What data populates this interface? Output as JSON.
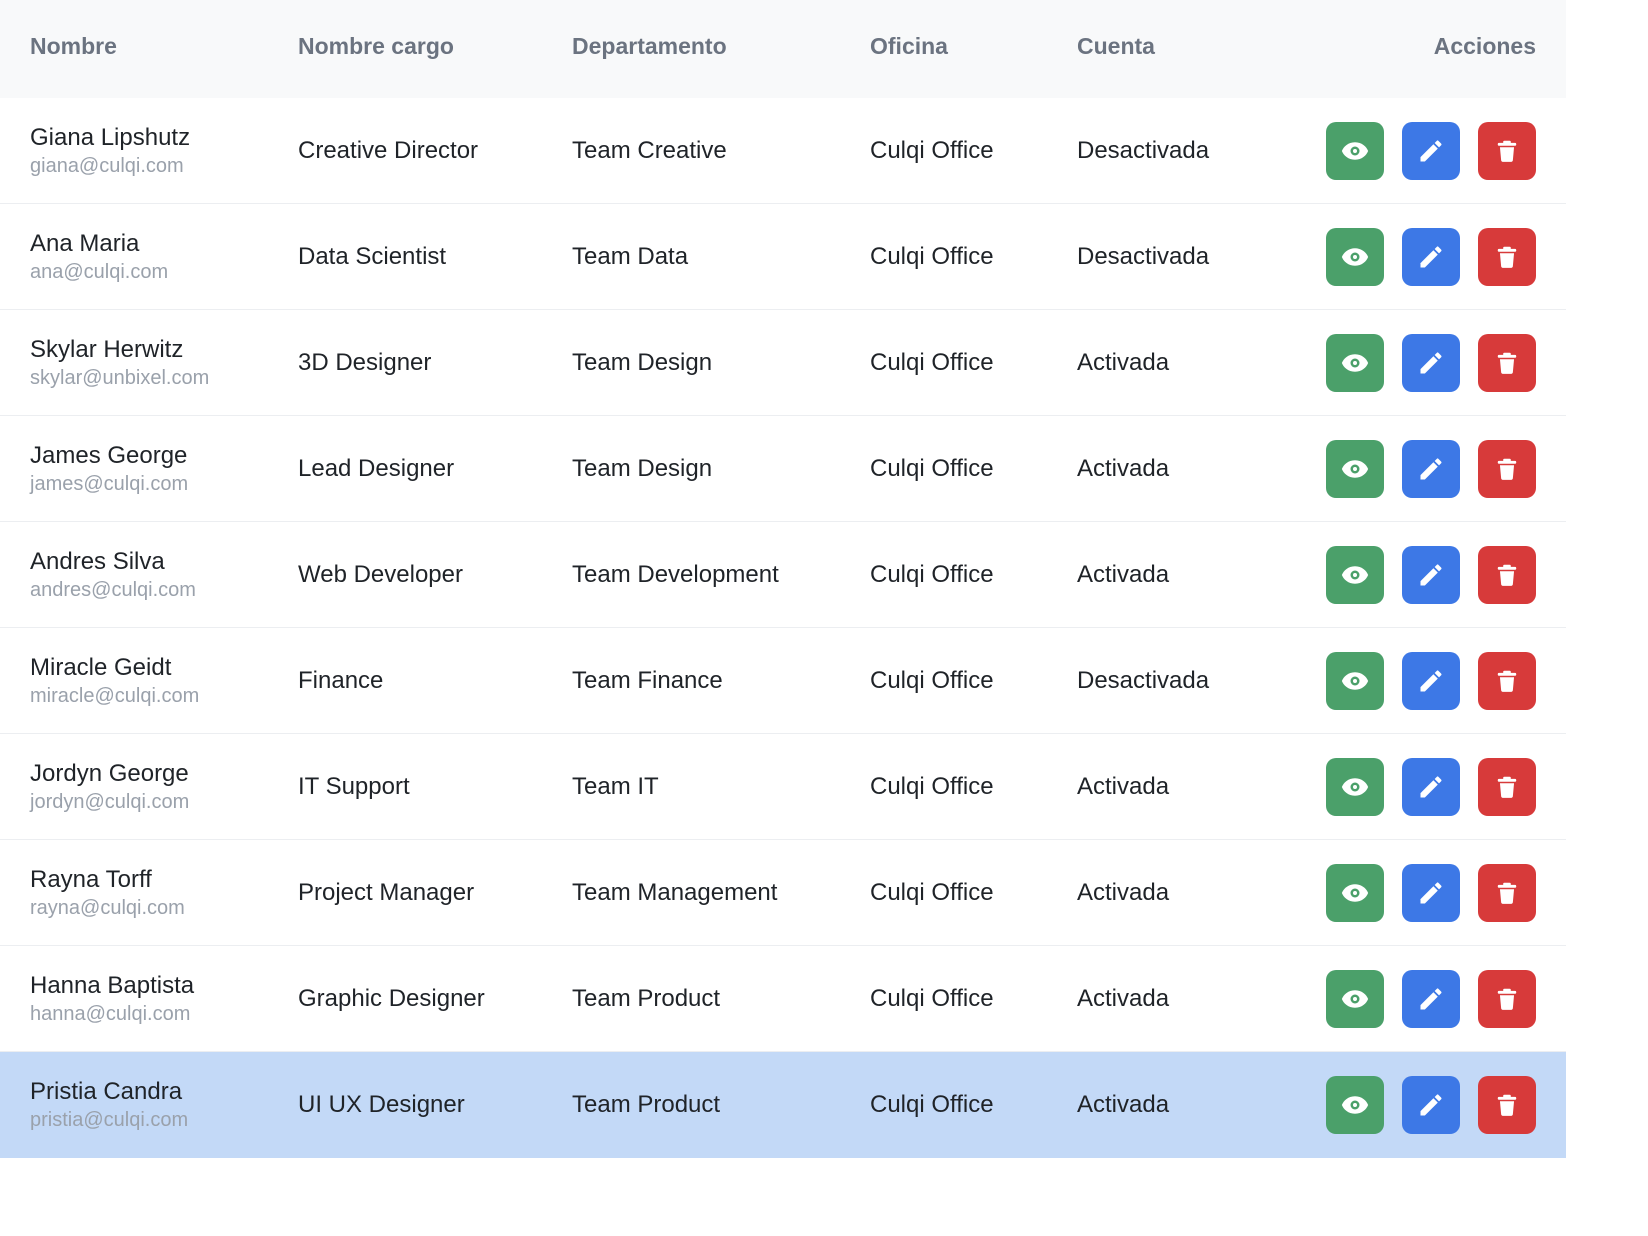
{
  "colors": {
    "view_button": "#4ba06a",
    "edit_button": "#3d78e6",
    "delete_button": "#d73a3a",
    "header_bg": "#f8f9fa",
    "selected_row_bg": "#c3d9f7"
  },
  "table": {
    "headers": {
      "name": "Nombre",
      "position": "Nombre cargo",
      "department": "Departamento",
      "office": "Oficina",
      "account": "Cuenta",
      "actions": "Acciones"
    },
    "rows": [
      {
        "name": "Giana Lipshutz",
        "email": "giana@culqi.com",
        "position": "Creative Director",
        "department": "Team Creative",
        "office": "Culqi Office",
        "account": "Desactivada"
      },
      {
        "name": "Ana Maria",
        "email": "ana@culqi.com",
        "position": "Data Scientist",
        "department": "Team Data",
        "office": "Culqi Office",
        "account": "Desactivada"
      },
      {
        "name": "Skylar Herwitz",
        "email": "skylar@unbixel.com",
        "position": "3D Designer",
        "department": "Team Design",
        "office": "Culqi Office",
        "account": "Activada"
      },
      {
        "name": "James George",
        "email": "james@culqi.com",
        "position": "Lead Designer",
        "department": "Team Design",
        "office": "Culqi Office",
        "account": "Activada"
      },
      {
        "name": "Andres Silva",
        "email": "andres@culqi.com",
        "position": "Web Developer",
        "department": "Team Development",
        "office": "Culqi Office",
        "account": "Activada"
      },
      {
        "name": "Miracle Geidt",
        "email": "miracle@culqi.com",
        "position": "Finance",
        "department": "Team Finance",
        "office": "Culqi Office",
        "account": "Desactivada"
      },
      {
        "name": "Jordyn George",
        "email": "jordyn@culqi.com",
        "position": "IT Support",
        "department": "Team IT",
        "office": "Culqi Office",
        "account": "Activada"
      },
      {
        "name": "Rayna Torff",
        "email": "rayna@culqi.com",
        "position": "Project Manager",
        "department": "Team Management",
        "office": "Culqi Office",
        "account": "Activada"
      },
      {
        "name": "Hanna Baptista",
        "email": "hanna@culqi.com",
        "position": "Graphic Designer",
        "department": "Team Product",
        "office": "Culqi Office",
        "account": "Activada"
      },
      {
        "name": "Pristia Candra",
        "email": "pristia@culqi.com",
        "position": "UI UX Designer",
        "department": "Team Product",
        "office": "Culqi Office",
        "account": "Activada",
        "selected": true
      }
    ],
    "row_actions": {
      "view_icon": "eye-icon",
      "edit_icon": "pencil-icon",
      "delete_icon": "trash-icon"
    }
  }
}
